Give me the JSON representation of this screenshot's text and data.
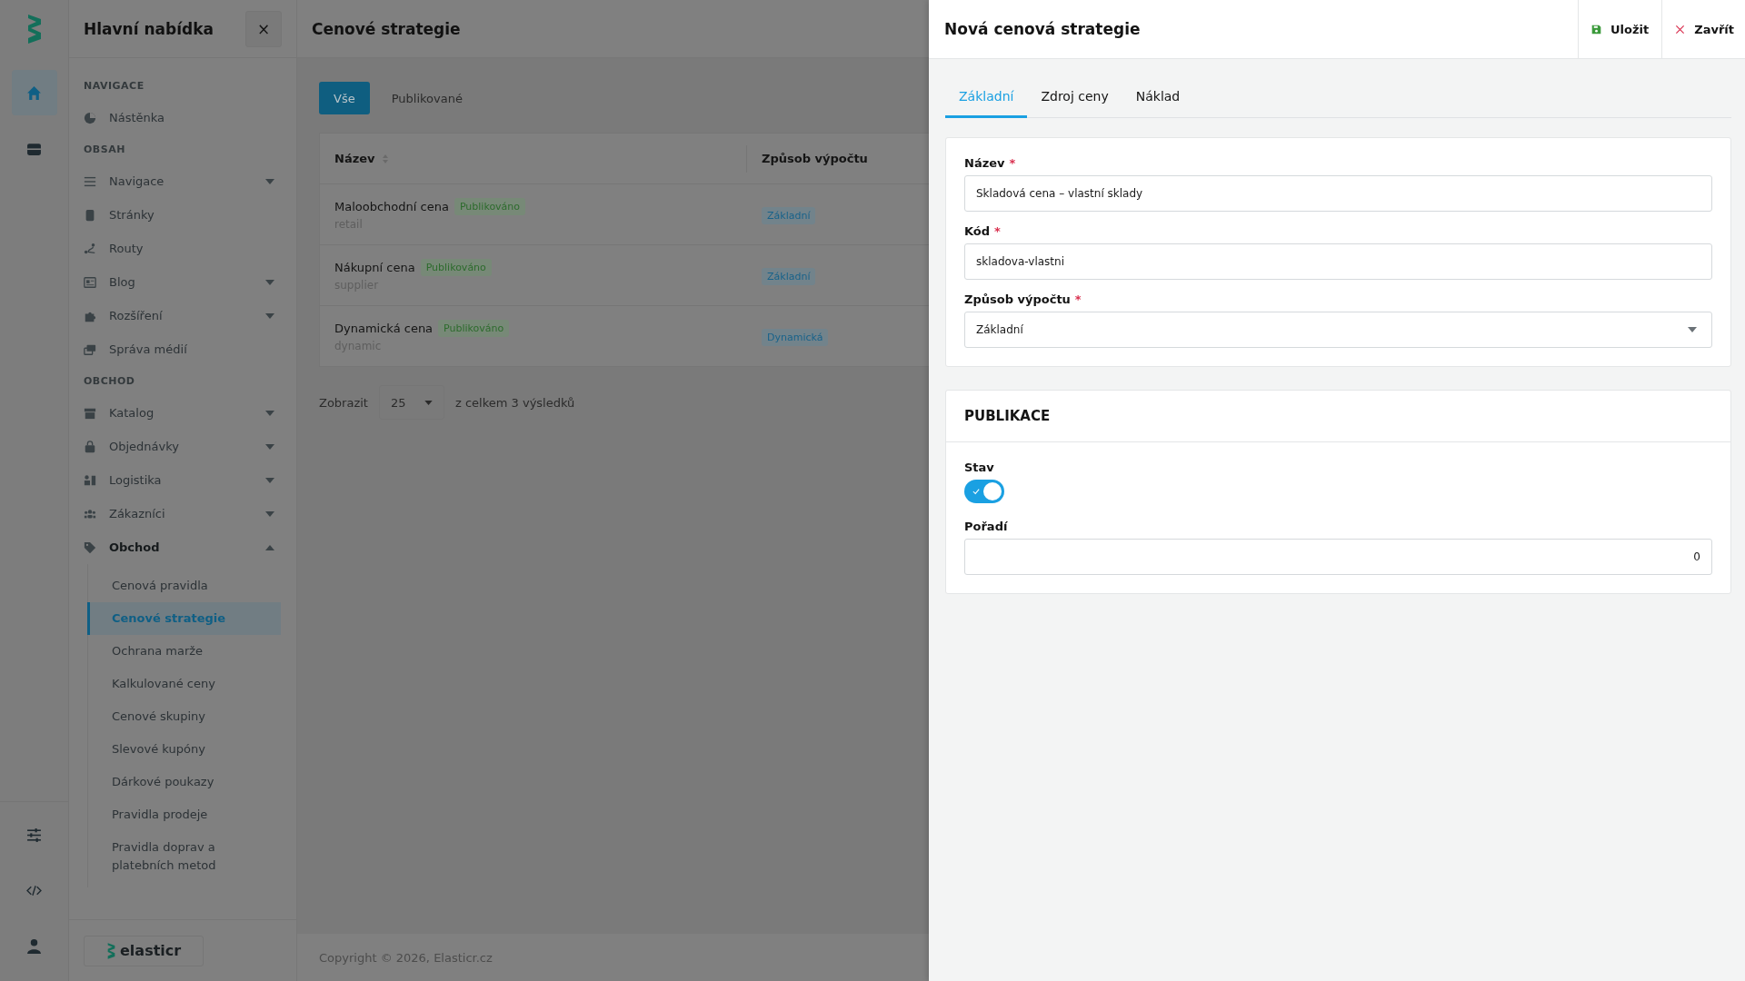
{
  "rail": {
    "items": [
      {
        "selected": true
      },
      {
        "selected": false
      }
    ]
  },
  "sidebar": {
    "title": "Hlavní nabídka",
    "close": "×",
    "logo_text": "elasticr",
    "sections": [
      {
        "label": "NAVIGACE",
        "items": [
          {
            "label": "Nástěnka"
          }
        ]
      },
      {
        "label": "OBSAH",
        "items": [
          {
            "label": "Navigace",
            "expanded": false
          },
          {
            "label": "Stránky"
          },
          {
            "label": "Routy"
          },
          {
            "label": "Blog",
            "expanded": false
          },
          {
            "label": "Rozšíření",
            "expanded": false
          },
          {
            "label": "Správa médií"
          }
        ]
      },
      {
        "label": "OBCHOD",
        "items": [
          {
            "label": "Katalog",
            "expanded": false
          },
          {
            "label": "Objednávky",
            "expanded": false
          },
          {
            "label": "Logistika",
            "expanded": false
          },
          {
            "label": "Zákazníci",
            "expanded": false
          },
          {
            "label": "Obchod",
            "expanded": true,
            "children": [
              {
                "label": "Cenová pravidla",
                "selected": false
              },
              {
                "label": "Cenové strategie",
                "selected": true
              },
              {
                "label": "Ochrana marže",
                "selected": false
              },
              {
                "label": "Kalkulované ceny",
                "selected": false
              },
              {
                "label": "Cenové skupiny",
                "selected": false
              },
              {
                "label": "Slevové kupóny",
                "selected": false
              },
              {
                "label": "Dárkové poukazy",
                "selected": false
              },
              {
                "label": "Pravidla prodeje",
                "selected": false
              },
              {
                "label": "Pravidla doprav a platebních metod",
                "selected": false
              }
            ]
          }
        ]
      }
    ]
  },
  "main": {
    "title": "Cenové strategie",
    "filters": [
      {
        "label": "Vše",
        "selected": true
      },
      {
        "label": "Publikované",
        "selected": false
      }
    ],
    "table": {
      "columns": [
        "Název",
        "Způsob výpočtu"
      ],
      "rows": [
        {
          "name": "Maloobchodní cena",
          "status": "Publikováno",
          "code": "retail",
          "method": "Základní"
        },
        {
          "name": "Nákupní cena",
          "status": "Publikováno",
          "code": "supplier",
          "method": "Základní"
        },
        {
          "name": "Dynamická cena",
          "status": "Publikováno",
          "code": "dynamic",
          "method": "Dynamická"
        }
      ]
    },
    "pagination": {
      "label": "Zobrazit",
      "per_page": "25",
      "summary": "z celkem 3 výsledků"
    },
    "footer": "Copyright © 2026, Elasticr.cz"
  },
  "drawer": {
    "title": "Nová cenová strategie",
    "actions": [
      {
        "label": "Uložit",
        "kind": "save"
      },
      {
        "label": "Zavřít",
        "kind": "close"
      }
    ],
    "tabs": [
      {
        "label": "Základní",
        "selected": true
      },
      {
        "label": "Zdroj ceny",
        "selected": false
      },
      {
        "label": "Náklad",
        "selected": false
      }
    ],
    "fields": [
      {
        "label": "Název",
        "required_mark": "*",
        "kind": "text",
        "value": "Skladová cena – vlastní sklady"
      },
      {
        "label": "Kód",
        "required_mark": "*",
        "kind": "text",
        "value": "skladova-vlastni"
      },
      {
        "label": "Způsob výpočtu",
        "required_mark": "*",
        "kind": "select",
        "value": "Základní"
      }
    ],
    "publication": {
      "heading": "PUBLIKACE",
      "status_label": "Stav",
      "on": true,
      "order_label": "Pořadí",
      "order_value": "0"
    }
  }
}
